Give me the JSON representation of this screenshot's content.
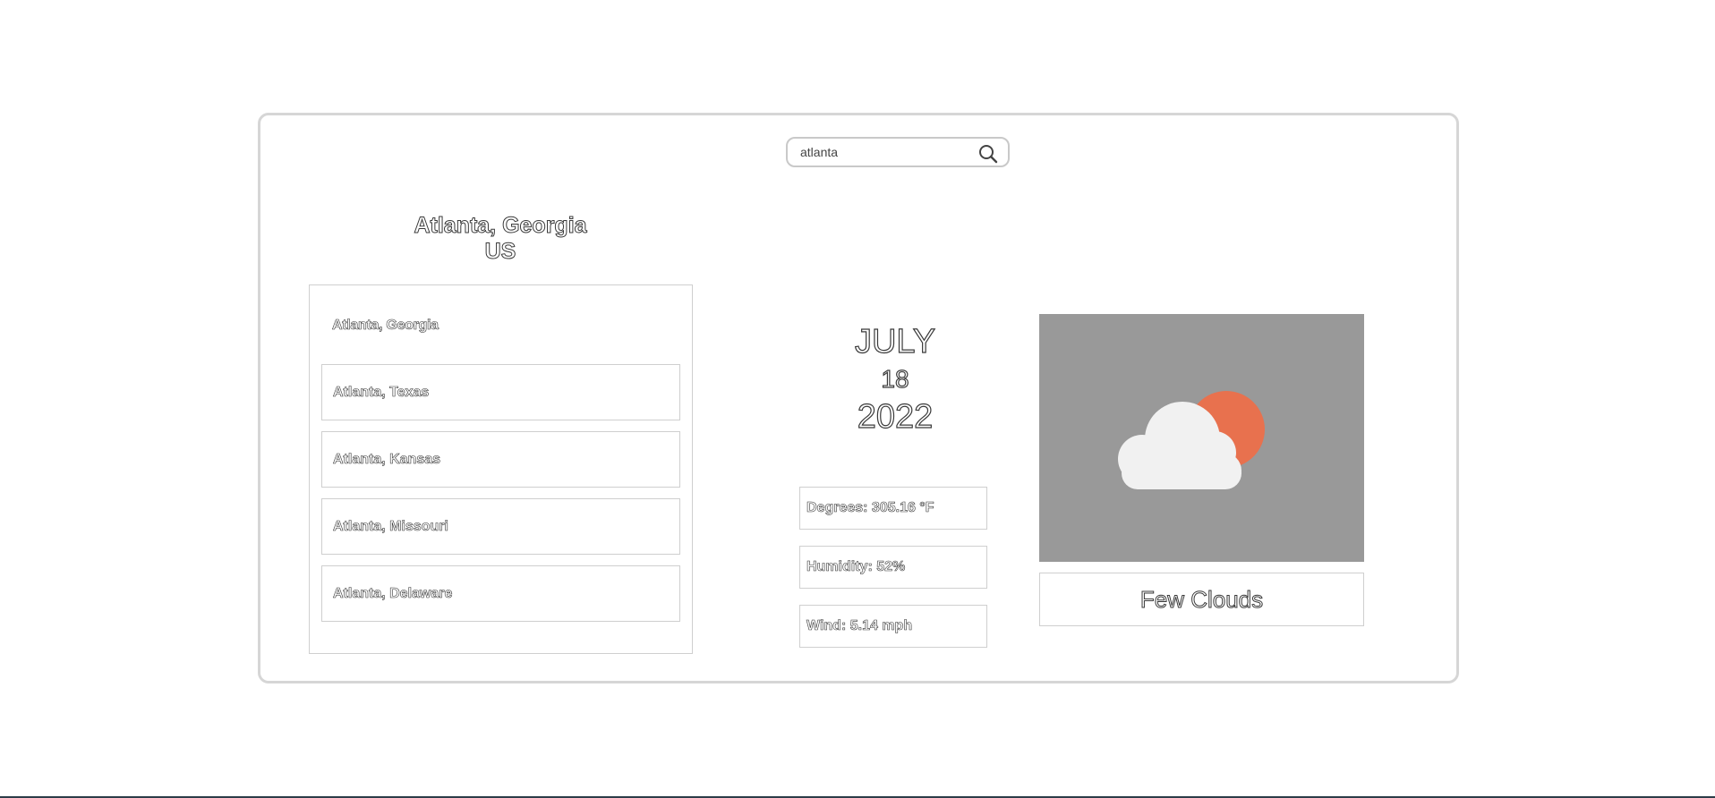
{
  "search": {
    "value": "atlanta",
    "icon": "search-icon"
  },
  "location": {
    "city_state": "Atlanta, Georgia",
    "country": "US"
  },
  "results": {
    "selected": "Atlanta, Georgia",
    "items": [
      {
        "label": "Atlanta, Texas"
      },
      {
        "label": "Atlanta, Kansas"
      },
      {
        "label": "Atlanta, Missouri"
      },
      {
        "label": "Atlanta, Delaware"
      }
    ]
  },
  "date": {
    "month": "JULY",
    "day": "18",
    "year": "2022"
  },
  "stats": {
    "degrees": "Degrees: 305.16 °F",
    "humidity": "Humidity: 52%",
    "wind": "Wind: 5.14 mph"
  },
  "weather": {
    "icon": "few-clouds-icon",
    "description": "Few Clouds",
    "colors": {
      "image_bg": "#999999",
      "sun": "#e8714e",
      "cloud": "#f1f1f1"
    }
  }
}
